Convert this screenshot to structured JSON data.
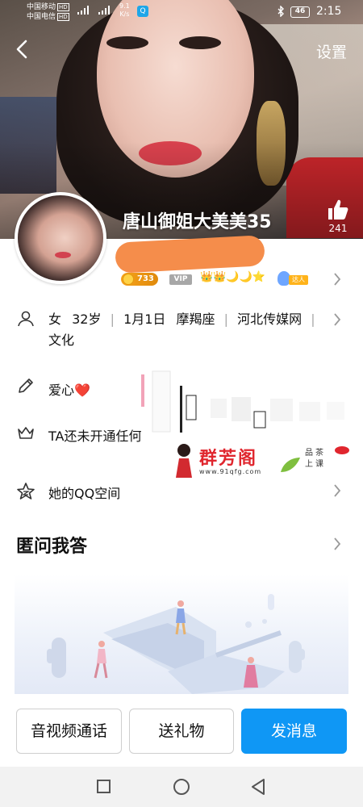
{
  "status_bar": {
    "carrier_1": "中国移动",
    "carrier_2": "中国电信",
    "hd": "HD",
    "net_speed_value": "9.1",
    "net_speed_unit": "K/s",
    "battery": "46",
    "time": "2:15"
  },
  "nav": {
    "settings_label": "设置"
  },
  "profile": {
    "nickname": "唐山御姐大美美35",
    "likes": "241",
    "coin_count": "733",
    "vip_label": "VIP",
    "level_icons": "👑👑🌙🌙⭐",
    "talent_label": "达人"
  },
  "info": {
    "gender": "女",
    "age": "32岁",
    "birthday": "1月1日",
    "zodiac": "摩羯座",
    "company": "河北传媒网",
    "occupation": "文化",
    "separator": "|"
  },
  "rows": {
    "signature": "爱心❤️",
    "privilege": "TA还未开通任何",
    "qzone": "她的QQ空间"
  },
  "watermark": {
    "title": "群芳阁",
    "url": "www.91qfg.com",
    "tagline_1": "品茶",
    "tagline_2": "上课"
  },
  "section": {
    "title": "匿问我答"
  },
  "actions": {
    "video_call": "音视频通话",
    "send_gift": "送礼物",
    "send_message": "发消息"
  },
  "colors": {
    "primary": "#0f97f5",
    "coin": "#f6a21a",
    "heart": "#e0262e"
  }
}
